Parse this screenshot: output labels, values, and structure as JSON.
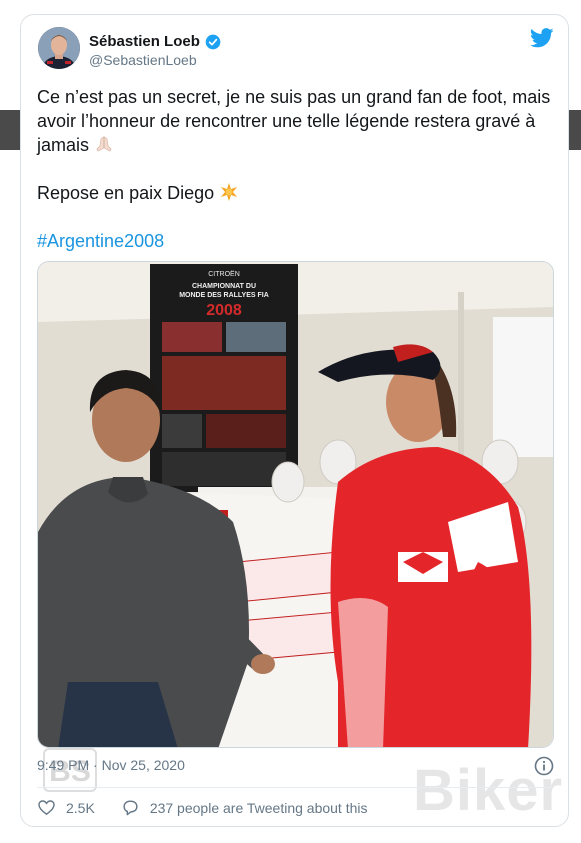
{
  "tweet": {
    "author_name": "Sébastien Loeb",
    "author_handle": "@SebastienLoeb",
    "text_line1": "Ce n’est pas un secret, je ne suis pas un grand fan de foot, mais avoir l’honneur de rencontrer une telle légende restera gravé à jamais",
    "text_line2": "Repose en paix Diego",
    "hashtag": "#Argentine2008",
    "timestamp": "9:49 PM · Nov 25, 2020",
    "likes": "2.5K",
    "tweeting_about": "237 people are Tweeting about this"
  },
  "photo": {
    "poster_brand": "CITROËN",
    "poster_line1": "CHAMPIONNAT DU",
    "poster_line2": "MONDE DES RALLYES FIA",
    "poster_year": "2008"
  },
  "watermarks": {
    "left": "BS",
    "right": "Biker"
  },
  "icons": [
    "verified-badge-icon",
    "twitter-bird-icon",
    "praying-hands-icon",
    "star-icon",
    "info-icon",
    "heart-icon",
    "speech-bubble-icon"
  ],
  "colors": {
    "twitter_blue": "#1da1f2",
    "hashtag": "#1b95e0",
    "muted": "#657786",
    "text": "#14171a"
  }
}
